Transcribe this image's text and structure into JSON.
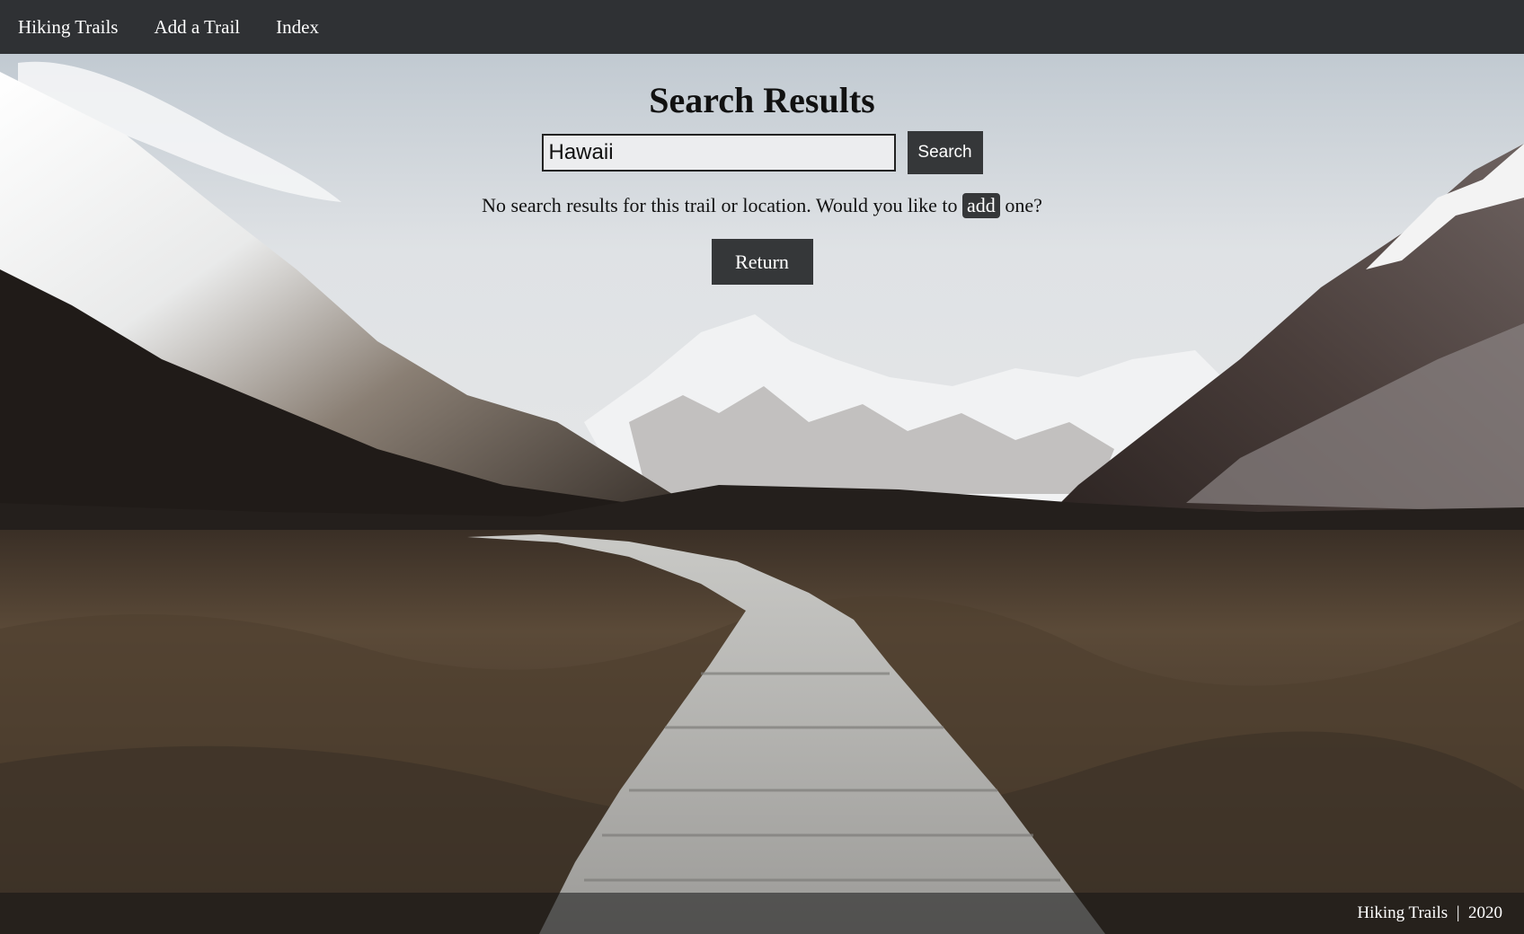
{
  "nav": {
    "brand": "Hiking Trails",
    "add_trail": "Add a Trail",
    "index": "Index"
  },
  "page": {
    "title": "Search Results"
  },
  "search": {
    "value": "Hawaii",
    "button_label": "Search"
  },
  "results": {
    "message_before": "No search results for this trail or location. Would you like to",
    "add_label": "add",
    "message_after": "one?",
    "return_label": "Return"
  },
  "footer": {
    "text": "Hiking Trails  |  2020"
  },
  "colors": {
    "navbar": "#2f3134",
    "button": "#353739",
    "sky": "#d6dade"
  }
}
